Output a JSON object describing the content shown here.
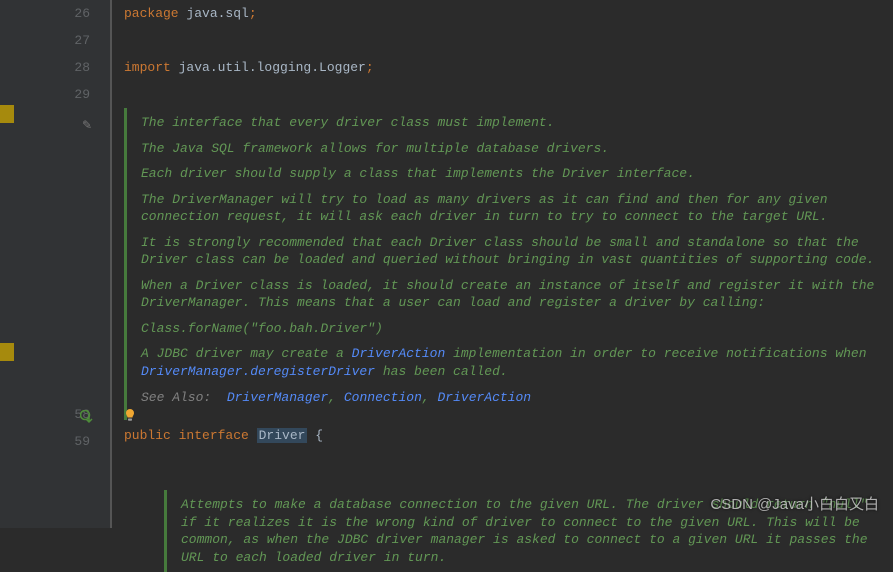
{
  "gutter": {
    "lines": [
      "26",
      "27",
      "28",
      "29"
    ],
    "docStartLine": "",
    "declLine": "58",
    "afterLine": "59"
  },
  "code": {
    "packageKw": "package",
    "packageName": " java.sql",
    "semi": ";",
    "importKw": "import",
    "importName": " java.util.logging.Logger",
    "publicKw": "public ",
    "interfaceKw": "interface ",
    "className": "Driver",
    "brace": " {"
  },
  "doc": {
    "p1": "The interface that every driver class must implement.",
    "p2": "The Java SQL framework allows for multiple database drivers.",
    "p3": "Each driver should supply a class that implements the Driver interface.",
    "p4": "The DriverManager will try to load as many drivers as it can find and then for any given connection request, it will ask each driver in turn to try to connect to the target URL.",
    "p5": "It is strongly recommended that each Driver class should be small and standalone so that the Driver class can be loaded and queried without bringing in vast quantities of supporting code.",
    "p6": "When a Driver class is loaded, it should create an instance of itself and register it with the DriverManager. This means that a user can load and register a driver by calling:",
    "codeLine": "Class.forName(\"foo.bah.Driver\")",
    "p7a": "A JDBC driver may create a ",
    "p7link": "DriverAction",
    "p7b": " implementation in order to receive notifications when ",
    "p7link2": "DriverManager.deregisterDriver",
    "p7c": " has been called.",
    "seeAlsoLabel": "See Also:",
    "see1": "DriverManager",
    "sep": ", ",
    "see2": "Connection",
    "see3": "DriverAction"
  },
  "innerDoc": {
    "p1": "Attempts to make a database connection to the given URL. The driver should return \"null\" if it realizes it is the wrong kind of driver to connect to the given URL. This will be common, as when the JDBC driver manager is asked to connect to a given URL it passes the URL to each loaded driver in turn."
  },
  "watermark": "CSDN @Java小白白又白"
}
